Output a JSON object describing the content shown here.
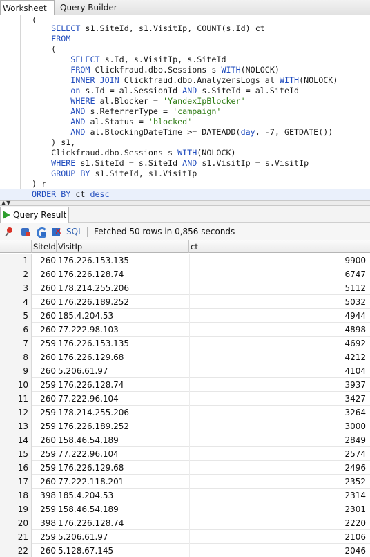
{
  "tabs": {
    "worksheet": "Worksheet",
    "query_builder": "Query Builder"
  },
  "editor": {
    "lines": [
      "(",
      "    SELECT s1.SiteId, s1.VisitIp, COUNT(s.Id) ct",
      "    FROM",
      "    (",
      "        SELECT s.Id, s.VisitIp, s.SiteId",
      "        FROM Clickfraud.dbo.Sessions s WITH(NOLOCK)",
      "        INNER JOIN Clickfraud.dbo.AnalyzersLogs al WITH(NOLOCK)",
      "        on s.Id = al.SessionId AND s.SiteId = al.SiteId",
      "        WHERE al.Blocker = 'YandexIpBlocker'",
      "        AND s.ReferrerType = 'campaign'",
      "        AND al.Status = 'blocked'",
      "        AND al.BlockingDateTime >= DATEADD(day, -7, GETDATE())",
      "    ) s1,",
      "    Clickfraud.dbo.Sessions s WITH(NOLOCK)",
      "    WHERE s1.SiteId = s.SiteId AND s1.VisitIp = s.VisitIp",
      "    GROUP BY s1.SiteId, s1.VisitIp",
      ") r",
      "ORDER BY ct desc"
    ]
  },
  "result": {
    "tab_label": "Query Result",
    "sql_label": "SQL",
    "status": "Fetched 50 rows in 0,856 seconds",
    "icons": [
      "pin-icon",
      "export-icon",
      "refresh-icon",
      "cancel-icon",
      "play-icon"
    ],
    "columns": [
      "SiteId",
      "VisitIp",
      "ct"
    ],
    "rows": [
      {
        "n": "1",
        "siteid": "260",
        "visitip": "176.226.153.135",
        "ct": "9900"
      },
      {
        "n": "2",
        "siteid": "260",
        "visitip": "176.226.128.74",
        "ct": "6747"
      },
      {
        "n": "3",
        "siteid": "260",
        "visitip": "178.214.255.206",
        "ct": "5112"
      },
      {
        "n": "4",
        "siteid": "260",
        "visitip": "176.226.189.252",
        "ct": "5032"
      },
      {
        "n": "5",
        "siteid": "260",
        "visitip": "185.4.204.53",
        "ct": "4944"
      },
      {
        "n": "6",
        "siteid": "260",
        "visitip": "77.222.98.103",
        "ct": "4898"
      },
      {
        "n": "7",
        "siteid": "259",
        "visitip": "176.226.153.135",
        "ct": "4692"
      },
      {
        "n": "8",
        "siteid": "260",
        "visitip": "176.226.129.68",
        "ct": "4212"
      },
      {
        "n": "9",
        "siteid": "260",
        "visitip": "5.206.61.97",
        "ct": "4104"
      },
      {
        "n": "10",
        "siteid": "259",
        "visitip": "176.226.128.74",
        "ct": "3937"
      },
      {
        "n": "11",
        "siteid": "260",
        "visitip": "77.222.96.104",
        "ct": "3427"
      },
      {
        "n": "12",
        "siteid": "259",
        "visitip": "178.214.255.206",
        "ct": "3264"
      },
      {
        "n": "13",
        "siteid": "259",
        "visitip": "176.226.189.252",
        "ct": "3000"
      },
      {
        "n": "14",
        "siteid": "260",
        "visitip": "158.46.54.189",
        "ct": "2849"
      },
      {
        "n": "15",
        "siteid": "259",
        "visitip": "77.222.96.104",
        "ct": "2574"
      },
      {
        "n": "16",
        "siteid": "259",
        "visitip": "176.226.129.68",
        "ct": "2496"
      },
      {
        "n": "17",
        "siteid": "260",
        "visitip": "77.222.118.201",
        "ct": "2352"
      },
      {
        "n": "18",
        "siteid": "398",
        "visitip": "185.4.204.53",
        "ct": "2314"
      },
      {
        "n": "19",
        "siteid": "259",
        "visitip": "158.46.54.189",
        "ct": "2301"
      },
      {
        "n": "20",
        "siteid": "398",
        "visitip": "176.226.128.74",
        "ct": "2220"
      },
      {
        "n": "21",
        "siteid": "259",
        "visitip": "5.206.61.97",
        "ct": "2106"
      },
      {
        "n": "22",
        "siteid": "260",
        "visitip": "5.128.67.145",
        "ct": "2046"
      }
    ]
  },
  "colors": {
    "keyword": "#1f4bbd",
    "string": "#2c7a12",
    "current_line": "#eaf0fb"
  }
}
